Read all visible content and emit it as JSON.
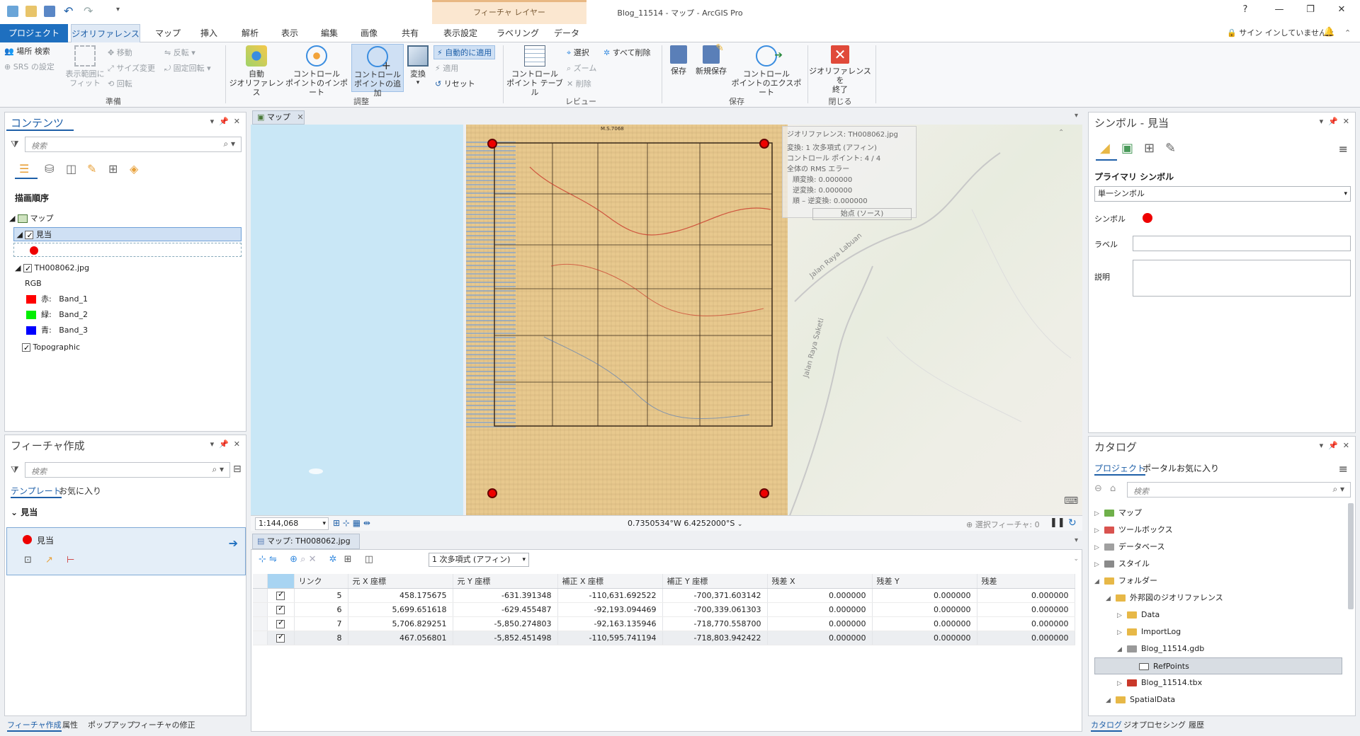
{
  "window": {
    "title": "Blog_11514 - マップ - ArcGIS Pro",
    "context_group": "フィーチャ レイヤー",
    "help": "?",
    "minimize": "—",
    "restore": "❐",
    "close": "✕"
  },
  "tabs": {
    "file": "プロジェクト",
    "items": [
      "ジオリファレンス",
      "マップ",
      "挿入",
      "解析",
      "表示",
      "編集",
      "画像",
      "共有",
      "表示設定",
      "ラベリング",
      "データ"
    ],
    "signin": "サイン インしていません ▾"
  },
  "ribbon": {
    "prepare": {
      "locate": "場所 検索",
      "srs": "SRS の設定",
      "fit": "表示範囲に\nフィット",
      "move": "移動",
      "scale": "サイズ変更",
      "rotate": "回転",
      "flip": "反転 ▾",
      "fixed_rotate": "固定回転 ▾",
      "label": "準備"
    },
    "adjust": {
      "auto": "自動\nジオリファレンス",
      "import": "コントロール\nポイントのインポート",
      "add": "コントロール\nポイントの追加",
      "transform": "変換",
      "auto_apply": "自動的に適用",
      "apply": "適用",
      "reset": "リセット",
      "label": "調整"
    },
    "review": {
      "table": "コントロール\nポイント テーブル",
      "select": "選択",
      "zoom": "ズーム",
      "delete": "削除",
      "delete_all": "すべて削除",
      "label": "レビュー"
    },
    "save": {
      "save": "保存",
      "save_new": "新規保存",
      "export": "コントロール\nポイントのエクスポート",
      "label": "保存"
    },
    "close": {
      "close": "ジオリファレンスを\n終了",
      "label": "閉じる"
    }
  },
  "contents": {
    "title": "コンテンツ",
    "search_placeholder": "検索",
    "drawing_order": "描画順序",
    "map": "マップ",
    "layer_mitou": "見当",
    "raster": "TH008062.jpg",
    "rgb": "RGB",
    "bands": [
      {
        "label": "赤:",
        "band": "Band_1",
        "color": "#ff0000"
      },
      {
        "label": "緑:",
        "band": "Band_2",
        "color": "#00ee00"
      },
      {
        "label": "青:",
        "band": "Band_3",
        "color": "#0000ff"
      }
    ],
    "topographic": "Topographic"
  },
  "create_features": {
    "title": "フィーチャ作成",
    "search_placeholder": "検索",
    "tab_templates": "テンプレート",
    "tab_favorites": "お気に入り",
    "group": "見当",
    "template": "見当"
  },
  "left_bottom_tabs": [
    "フィーチャ作成",
    "属性",
    "ポップアップ",
    "フィーチャの修正"
  ],
  "map": {
    "tab": "マップ",
    "scale": "1:144,068",
    "coords": "0.7350534°W 6.4252000°S",
    "selected": "選択フィーチャ: 0",
    "sheet_header": "M.S.7068",
    "road_1": "Jalan Raya Labuan",
    "road_2": "Jalan Raya Saketi",
    "info": {
      "title": "ジオリファレンス: TH008062.jpg",
      "transform": "変換: 1 次多項式 (アフィン)",
      "cp": "コントロール ポイント: 4 / 4",
      "rms": "全体の RMS エラー",
      "forward": "順変換: 0.000000",
      "inverse": "逆変換: 0.000000",
      "forward_inverse": "順 – 逆変換: 0.000000",
      "source": "始点 (ソース)"
    }
  },
  "table_pane": {
    "tab": "マップ: TH008062.jpg",
    "transform": "1 次多項式 (アフィン)",
    "headers": [
      "リンク",
      "元 X 座標",
      "元 Y 座標",
      "補正 X 座標",
      "補正 Y 座標",
      "残差 X",
      "残差 Y",
      "残差"
    ],
    "rows": [
      [
        "5",
        "458.175675",
        "-631.391348",
        "-110,631.692522",
        "-700,371.603142",
        "0.000000",
        "0.000000",
        "0.000000"
      ],
      [
        "6",
        "5,699.651618",
        "-629.455487",
        "-92,193.094469",
        "-700,339.061303",
        "0.000000",
        "0.000000",
        "0.000000"
      ],
      [
        "7",
        "5,706.829251",
        "-5,850.274803",
        "-92,163.135946",
        "-718,770.558700",
        "0.000000",
        "0.000000",
        "0.000000"
      ],
      [
        "8",
        "467.056801",
        "-5,852.451498",
        "-110,595.741194",
        "-718,803.942422",
        "0.000000",
        "0.000000",
        "0.000000"
      ]
    ]
  },
  "symbology": {
    "title": "シンボル - 見当",
    "primary": "プライマリ シンボル",
    "type": "単一シンボル",
    "symbol": "シンボル",
    "label": "ラベル",
    "desc": "説明"
  },
  "catalog": {
    "title": "カタログ",
    "tabs": [
      "プロジェクト",
      "ポータル",
      "お気に入り"
    ],
    "search_placeholder": "検索",
    "items": [
      {
        "label": "マップ",
        "indent": 0
      },
      {
        "label": "ツールボックス",
        "indent": 0
      },
      {
        "label": "データベース",
        "indent": 0
      },
      {
        "label": "スタイル",
        "indent": 0
      },
      {
        "label": "フォルダー",
        "indent": 0
      },
      {
        "label": "外邦図のジオリファレンス",
        "indent": 1
      },
      {
        "label": "Data",
        "indent": 2
      },
      {
        "label": "ImportLog",
        "indent": 2
      },
      {
        "label": "Blog_11514.gdb",
        "indent": 2
      },
      {
        "label": "RefPoints",
        "indent": 3
      },
      {
        "label": "Blog_11514.tbx",
        "indent": 2
      },
      {
        "label": "SpatialData",
        "indent": 1
      }
    ],
    "bottom_tabs": [
      "カタログ",
      "ジオプロセシング",
      "履歴"
    ]
  }
}
